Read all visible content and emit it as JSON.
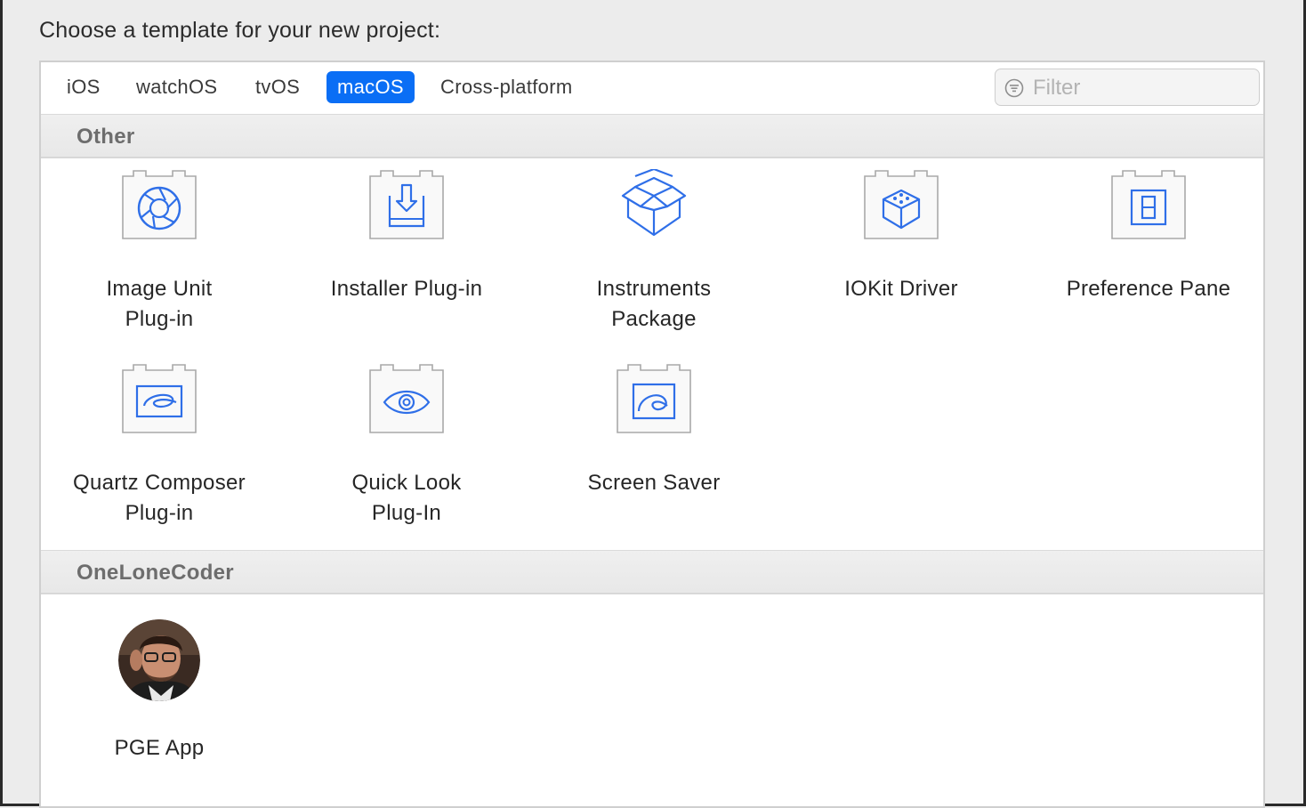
{
  "header": {
    "prompt": "Choose a template for your new project:"
  },
  "tabs": [
    {
      "label": "iOS"
    },
    {
      "label": "watchOS"
    },
    {
      "label": "tvOS"
    },
    {
      "label": "macOS",
      "active": true
    },
    {
      "label": "Cross-platform"
    }
  ],
  "filter": {
    "placeholder": "Filter",
    "value": ""
  },
  "sections": [
    {
      "title": "Other",
      "templates": [
        {
          "label": "Image Unit\nPlug-in",
          "icon": "aperture-icon"
        },
        {
          "label": "Installer Plug-in",
          "icon": "installer-download-icon"
        },
        {
          "label": "Instruments\nPackage",
          "icon": "open-box-icon"
        },
        {
          "label": "IOKit Driver",
          "icon": "cube-icon"
        },
        {
          "label": "Preference Pane",
          "icon": "preference-pane-icon"
        },
        {
          "label": "Quartz Composer\nPlug-in",
          "icon": "quartz-swirl-icon"
        },
        {
          "label": "Quick Look\nPlug-In",
          "icon": "eye-icon"
        },
        {
          "label": "Screen Saver",
          "icon": "screen-saver-icon"
        }
      ]
    },
    {
      "title": "OneLoneCoder",
      "templates": [
        {
          "label": "PGE App",
          "icon": "avatar-photo"
        }
      ]
    }
  ],
  "colors": {
    "accent": "#0a6ef5",
    "icon_blue": "#2f6fe8",
    "section_text": "#6d6d6d"
  }
}
